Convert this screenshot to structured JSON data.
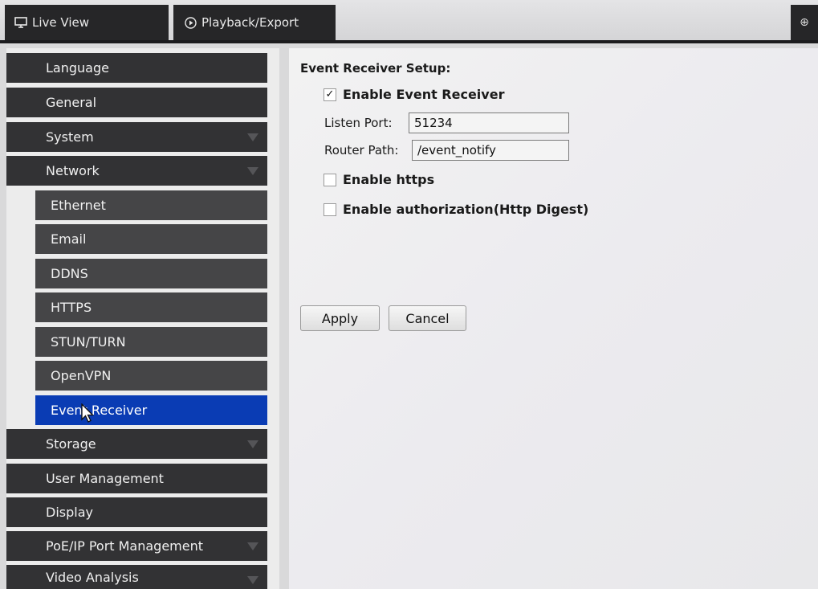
{
  "topbar": {
    "tabs": [
      {
        "label": "Live View",
        "icon": "monitor-icon"
      },
      {
        "label": "Playback/Export",
        "icon": "play-circle-icon"
      }
    ],
    "corner_icon": "plus-circle-icon",
    "corner_glyph": "⊕"
  },
  "sidebar": {
    "items": [
      {
        "label": "Language",
        "level": 1,
        "expandable": false
      },
      {
        "label": "General",
        "level": 1,
        "expandable": false
      },
      {
        "label": "System",
        "level": 1,
        "expandable": true
      },
      {
        "label": "Network",
        "level": 1,
        "expandable": true
      },
      {
        "label": "Ethernet",
        "level": 2
      },
      {
        "label": "Email",
        "level": 2
      },
      {
        "label": "DDNS",
        "level": 2
      },
      {
        "label": "HTTPS",
        "level": 2
      },
      {
        "label": "STUN/TURN",
        "level": 2
      },
      {
        "label": "OpenVPN",
        "level": 2
      },
      {
        "label": "Event Receiver",
        "level": 2,
        "selected": true
      },
      {
        "label": "Storage",
        "level": 1,
        "expandable": true
      },
      {
        "label": "User Management",
        "level": 1,
        "expandable": false
      },
      {
        "label": "Display",
        "level": 1,
        "expandable": false
      },
      {
        "label": "PoE/IP Port Management",
        "level": 1,
        "expandable": true
      },
      {
        "label": "Video Analysis",
        "level": 1,
        "expandable": true
      }
    ],
    "selected_color": "#0a3cb4"
  },
  "form": {
    "title": "Event Receiver Setup:",
    "enable_receiver": {
      "label": "Enable Event Receiver",
      "checked": true,
      "check_glyph": "✓"
    },
    "listen_port": {
      "label": "Listen Port:",
      "value": "51234"
    },
    "router_path": {
      "label": "Router Path:",
      "value": "/event_notify"
    },
    "enable_https": {
      "label": "Enable https",
      "checked": false
    },
    "enable_auth": {
      "label": "Enable authorization(Http Digest)",
      "checked": false
    },
    "apply_label": "Apply",
    "cancel_label": "Cancel"
  }
}
